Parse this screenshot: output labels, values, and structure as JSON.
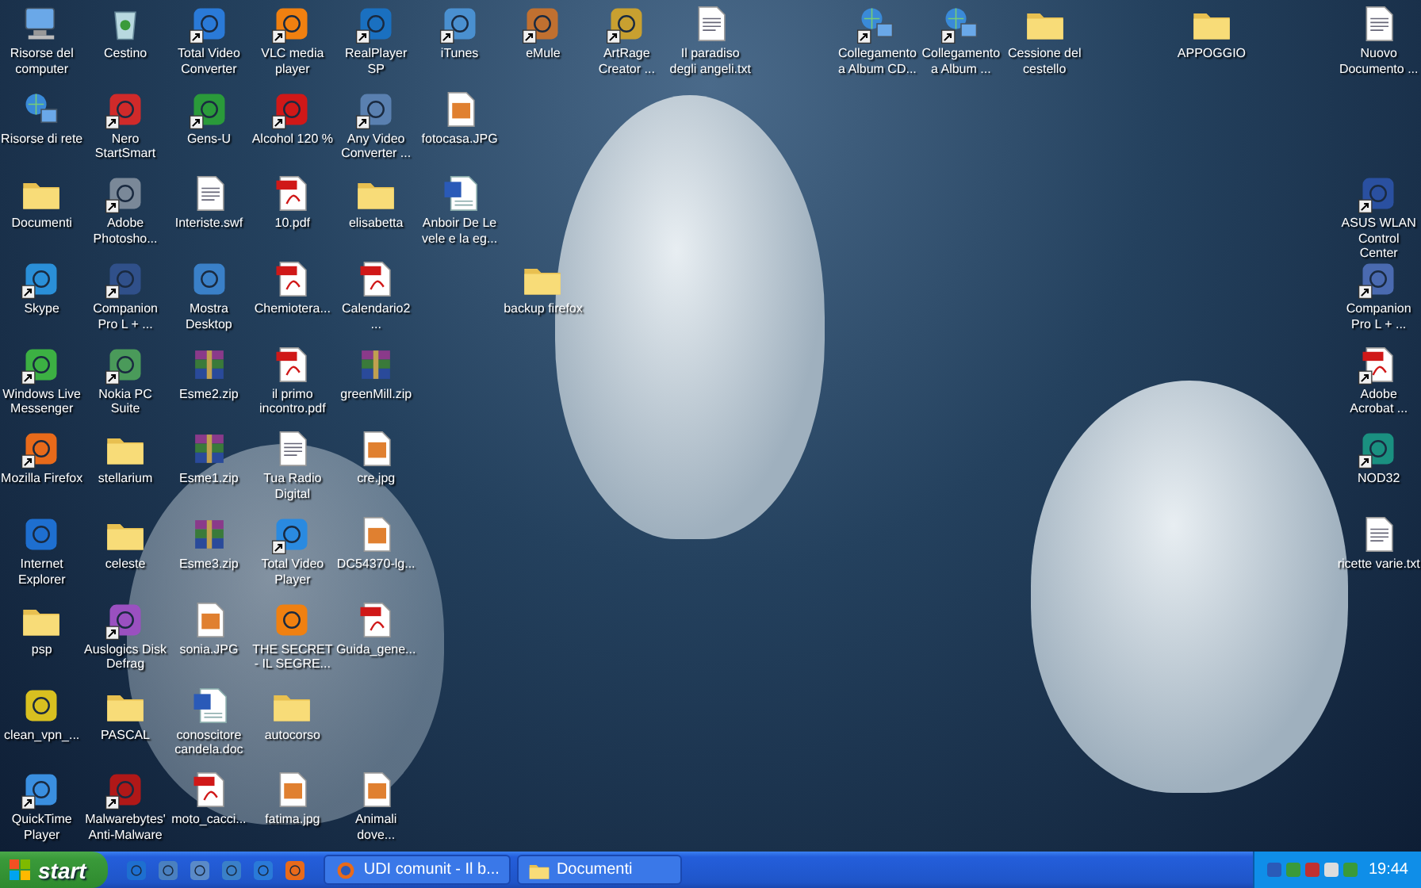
{
  "desktop": {
    "columns": [
      {
        "icons": [
          {
            "label": "Risorse del computer",
            "kind": "computer",
            "shortcut": false
          },
          {
            "label": "Risorse di rete",
            "kind": "network",
            "shortcut": false
          },
          {
            "label": "Documenti",
            "kind": "folder",
            "shortcut": false
          },
          {
            "label": "Skype",
            "kind": "app",
            "color": "#2a8fd8",
            "shortcut": true
          },
          {
            "label": "Windows Live Messenger",
            "kind": "app",
            "color": "#3cb043",
            "shortcut": true
          },
          {
            "label": "Mozilla Firefox",
            "kind": "app",
            "color": "#e86a1a",
            "shortcut": true
          },
          {
            "label": "Internet Explorer",
            "kind": "app",
            "color": "#1e6fd0",
            "shortcut": false
          },
          {
            "label": "psp",
            "kind": "folder",
            "shortcut": false
          },
          {
            "label": "clean_vpn_...",
            "kind": "app",
            "color": "#d8c020",
            "shortcut": false
          },
          {
            "label": "QuickTime Player",
            "kind": "app",
            "color": "#3a8fe0",
            "shortcut": true
          }
        ]
      },
      {
        "icons": [
          {
            "label": "Cestino",
            "kind": "recycle-bin",
            "shortcut": false
          },
          {
            "label": "Nero StartSmart",
            "kind": "app",
            "color": "#d02a2a",
            "shortcut": true
          },
          {
            "label": "Adobe Photosho...",
            "kind": "app",
            "color": "#7a8898",
            "shortcut": true
          },
          {
            "label": "Companion Pro L + ...",
            "kind": "app",
            "color": "#30508a",
            "shortcut": true
          },
          {
            "label": "Nokia PC Suite",
            "kind": "app",
            "color": "#4a9a5a",
            "shortcut": true
          },
          {
            "label": "stellarium",
            "kind": "folder",
            "shortcut": false
          },
          {
            "label": "celeste",
            "kind": "folder",
            "shortcut": false
          },
          {
            "label": "Auslogics Disk Defrag",
            "kind": "app",
            "color": "#9a50c0",
            "shortcut": true
          },
          {
            "label": "PASCAL",
            "kind": "folder",
            "shortcut": false
          },
          {
            "label": "Malwarebytes' Anti-Malware",
            "kind": "app",
            "color": "#b01818",
            "shortcut": true
          }
        ]
      },
      {
        "icons": [
          {
            "label": "Total Video Converter",
            "kind": "app",
            "color": "#2a7ad8",
            "shortcut": true
          },
          {
            "label": "Gens-U",
            "kind": "app",
            "color": "#2a9a3a",
            "shortcut": true
          },
          {
            "label": "Interiste.swf",
            "kind": "text",
            "shortcut": false
          },
          {
            "label": "Mostra Desktop",
            "kind": "app",
            "color": "#3a80c8",
            "shortcut": false
          },
          {
            "label": "Esme2.zip",
            "kind": "archive",
            "shortcut": false
          },
          {
            "label": "Esme1.zip",
            "kind": "archive",
            "shortcut": false
          },
          {
            "label": "Esme3.zip",
            "kind": "archive",
            "shortcut": false
          },
          {
            "label": "sonia.JPG",
            "kind": "image",
            "shortcut": false
          },
          {
            "label": "conoscitore candela.doc",
            "kind": "word",
            "shortcut": false
          },
          {
            "label": "moto_cacci...",
            "kind": "pdf",
            "shortcut": false
          }
        ]
      },
      {
        "icons": [
          {
            "label": "VLC media player",
            "kind": "app",
            "color": "#f08010",
            "shortcut": true
          },
          {
            "label": "Alcohol 120 %",
            "kind": "app",
            "color": "#d01818",
            "shortcut": true
          },
          {
            "label": "10.pdf",
            "kind": "pdf",
            "shortcut": false
          },
          {
            "label": "Chemiotera...",
            "kind": "pdf",
            "shortcut": false
          },
          {
            "label": "il primo incontro.pdf",
            "kind": "pdf",
            "shortcut": false
          },
          {
            "label": "Tua Radio Digital",
            "kind": "text",
            "shortcut": false
          },
          {
            "label": "Total Video Player",
            "kind": "app",
            "color": "#2a8ae0",
            "shortcut": true
          },
          {
            "label": "THE SECRET - IL SEGRE...",
            "kind": "app",
            "color": "#f08010",
            "shortcut": false
          },
          {
            "label": "autocorso",
            "kind": "folder",
            "shortcut": false
          },
          {
            "label": "fatima.jpg",
            "kind": "image",
            "shortcut": false
          }
        ]
      },
      {
        "icons": [
          {
            "label": "RealPlayer SP",
            "kind": "app",
            "color": "#1a70c0",
            "shortcut": true
          },
          {
            "label": "Any Video Converter ...",
            "kind": "app",
            "color": "#5a80b0",
            "shortcut": true
          },
          {
            "label": "elisabetta",
            "kind": "folder",
            "shortcut": false
          },
          {
            "label": "Calendario2 ...",
            "kind": "pdf",
            "shortcut": false
          },
          {
            "label": "greenMill.zip",
            "kind": "archive",
            "shortcut": false
          },
          {
            "label": "cre.jpg",
            "kind": "image",
            "shortcut": false
          },
          {
            "label": "DC54370-lg...",
            "kind": "image",
            "shortcut": false
          },
          {
            "label": "Guida_gene...",
            "kind": "pdf",
            "shortcut": false
          },
          {
            "kind": "gap"
          },
          {
            "label": "Animali dove...",
            "kind": "image",
            "shortcut": false
          }
        ]
      },
      {
        "icons": [
          {
            "label": "iTunes",
            "kind": "app",
            "color": "#4a90d0",
            "shortcut": true
          },
          {
            "label": "fotocasa.JPG",
            "kind": "image",
            "shortcut": false
          },
          {
            "label": "Anboir De Le vele e la eg...",
            "kind": "word",
            "shortcut": false
          }
        ]
      },
      {
        "icons": [
          {
            "label": "eMule",
            "kind": "app",
            "color": "#c07030",
            "shortcut": true
          },
          {
            "kind": "gap"
          },
          {
            "kind": "gap"
          },
          {
            "label": "backup firefox",
            "kind": "folder",
            "shortcut": false
          }
        ]
      },
      {
        "icons": [
          {
            "label": "ArtRage Creator ...",
            "kind": "app",
            "color": "#c8a030",
            "shortcut": true
          }
        ]
      },
      {
        "icons": [
          {
            "label": "Il paradiso degli angeli.txt",
            "kind": "text",
            "shortcut": false
          }
        ]
      },
      {
        "gap_before": true,
        "icons": [
          {
            "label": "Collegamento a Album CD...",
            "kind": "network",
            "shortcut": true
          }
        ]
      },
      {
        "icons": [
          {
            "label": "Collegamento a Album ...",
            "kind": "network",
            "shortcut": true
          }
        ]
      },
      {
        "icons": [
          {
            "label": "Cessione del cestello",
            "kind": "folder",
            "shortcut": false
          }
        ]
      },
      {
        "gap_before": true,
        "icons": [
          {
            "label": "APPOGGIO",
            "kind": "folder",
            "shortcut": false
          }
        ]
      },
      {
        "gap_before": true,
        "icons": [
          {
            "label": "Nuovo Documento ...",
            "kind": "text",
            "shortcut": false
          },
          {
            "kind": "gap"
          },
          {
            "label": "ASUS WLAN Control Center",
            "kind": "app",
            "color": "#2a50a0",
            "shortcut": true
          },
          {
            "label": "Companion Pro L + ...",
            "kind": "app",
            "color": "#4a6ab0",
            "shortcut": true
          },
          {
            "label": "Adobe Acrobat ...",
            "kind": "pdf",
            "shortcut": true
          },
          {
            "label": "NOD32",
            "kind": "app",
            "color": "#1a9080",
            "shortcut": true
          },
          {
            "label": "ricette varie.txt",
            "kind": "text",
            "shortcut": false
          }
        ]
      }
    ]
  },
  "taskbar": {
    "start": "start",
    "quick_launch": [
      {
        "kind": "app",
        "color": "#1e6fd0"
      },
      {
        "kind": "app",
        "color": "#4a80c0"
      },
      {
        "kind": "app",
        "color": "#5a8ac8"
      },
      {
        "kind": "app",
        "color": "#3a80c8"
      },
      {
        "kind": "app",
        "color": "#2a7ad8"
      },
      {
        "kind": "app",
        "color": "#e86a1a"
      }
    ],
    "tasks": [
      {
        "label": "UDI comunit - Il b...",
        "kind": "browser",
        "selected": false
      },
      {
        "label": "Documenti",
        "kind": "folder",
        "selected": false
      }
    ],
    "clock": "19:44"
  }
}
